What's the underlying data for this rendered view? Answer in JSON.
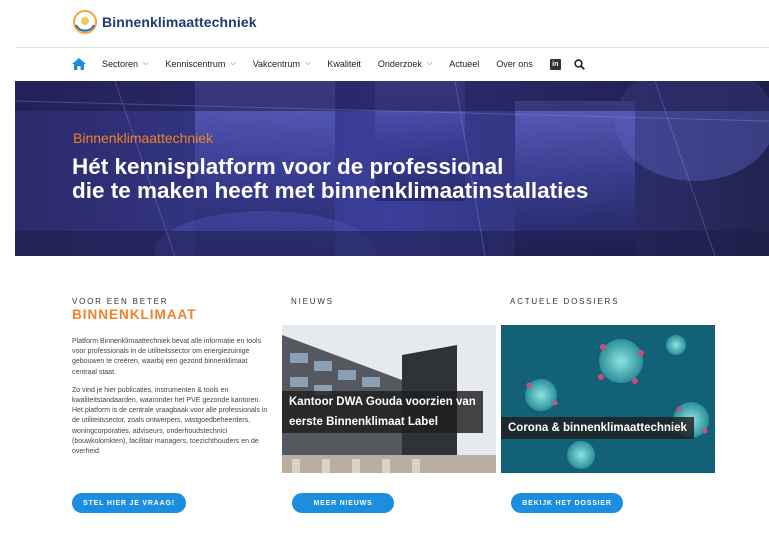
{
  "header": {
    "logo_text": "Binnenklimaattechniek"
  },
  "nav": {
    "items": [
      {
        "label": "Sectoren",
        "dropdown": true
      },
      {
        "label": "Kenniscentrum",
        "dropdown": true
      },
      {
        "label": "Vakcentrum",
        "dropdown": true
      },
      {
        "label": "Kwaliteit",
        "dropdown": false
      },
      {
        "label": "Onderzoek",
        "dropdown": true
      },
      {
        "label": "Actueel",
        "dropdown": false
      },
      {
        "label": "Over ons",
        "dropdown": false
      }
    ],
    "linkedin_label": "in",
    "icons": [
      "home-icon",
      "linkedin-icon",
      "search-icon"
    ]
  },
  "hero": {
    "kicker": "Binnenklimaattechniek",
    "title_line1": "Hét kennisplatform voor de professional",
    "title_line2": "die te maken heeft met binnenklimaatinstallaties"
  },
  "intro": {
    "heading_small": "VOOR EEN BETER",
    "heading_big": "BINNENKLIMAAT",
    "paragraph1": "Platform Binnenklimaattechniek bevat alle informatie en tools voor professionals in de utiliteitssector om energiezuinige gebouwen te creëren, waarbij een gezond binnenklimaat centraal staat.",
    "paragraph2": "Zo vind je hier publicaties, instrumenten & tools en kwaliteitstandaarden, waaronder het PVE gezonde kantoren. Het platform is de centrale vraagbaak voor alle professionals in de utiliteitssector, zoals ontwerpers, vastgoedbeheerders, woningcorporaties, adviseurs, onderhoudstechnici (bouwkolomkten), facilitair managers, toezichthouders en de overheid.",
    "button": "STEL HIER JE VRAAG!"
  },
  "news": {
    "heading": "NIEUWS",
    "caption_line1": "Kantoor DWA Gouda voorzien van",
    "caption_line2": "eerste Binnenklimaat Label",
    "button": "MEER NIEUWS"
  },
  "dossiers": {
    "heading": "ACTUELE DOSSIERS",
    "caption": "Corona & binnenklimaattechniek",
    "button": "BEKIJK HET DOSSIER"
  },
  "colors": {
    "accent_orange": "#f0812a",
    "button_blue": "#1b8ee0",
    "logo_navy": "#1e3a6e"
  }
}
